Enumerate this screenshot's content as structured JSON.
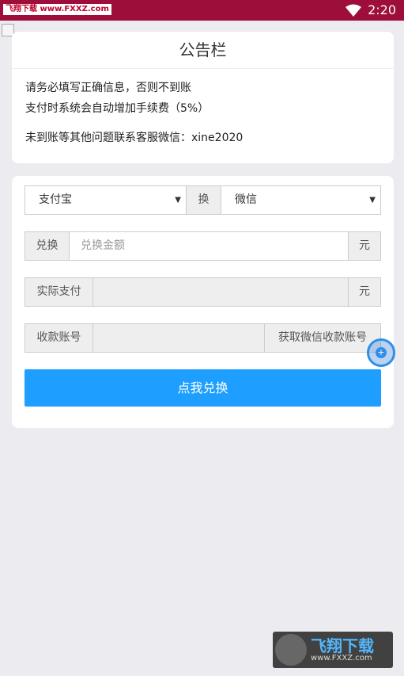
{
  "status_bar": {
    "site_tag": "飞翔下载 www.FXXZ.com",
    "time": "2:20"
  },
  "notice": {
    "title": "公告栏",
    "lines": [
      "请务必填写正确信息，否则不到账",
      "支付时系统会自动增加手续费（5%）",
      "未到账等其他问题联系客服微信：xine2020"
    ]
  },
  "form": {
    "from_method": "支付宝",
    "swap_label": "换",
    "to_method": "微信",
    "exchange_label": "兑换",
    "exchange_placeholder": "兑换金额",
    "unit": "元",
    "actual_pay_label": "实际支付",
    "account_label": "收款账号",
    "get_account_button": "获取微信收款账号",
    "submit": "点我兑换"
  },
  "watermark": {
    "brand": "飞翔下载",
    "url": "www.FXXZ.com"
  },
  "colors": {
    "status_bar": "#9d0e3a",
    "primary": "#1e9fff",
    "background": "#ebebf0"
  }
}
